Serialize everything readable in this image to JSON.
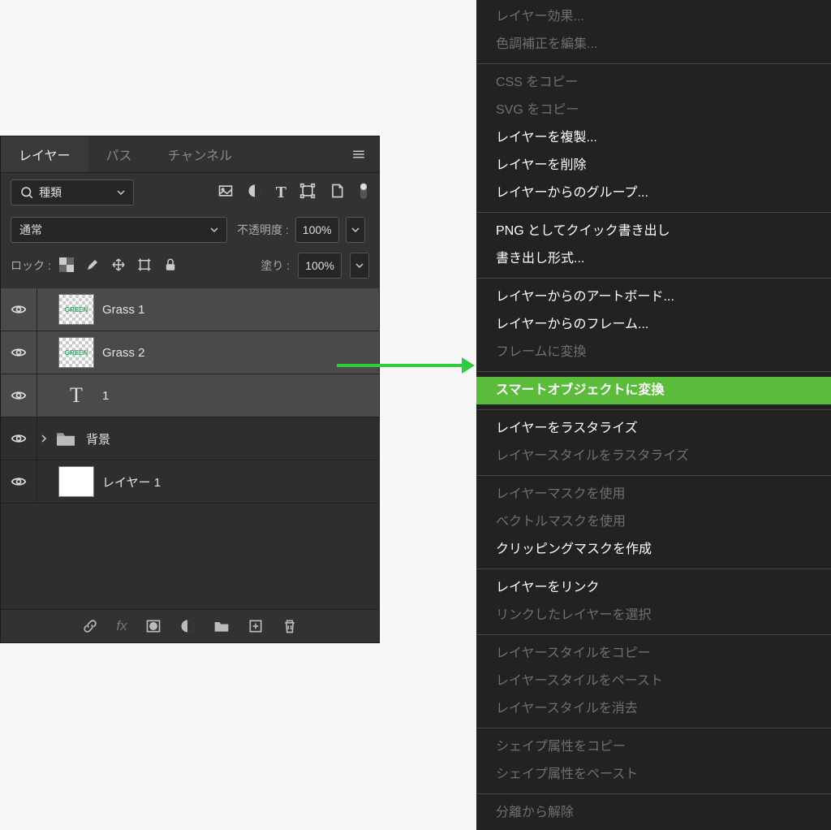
{
  "panel": {
    "tabs": {
      "layers": "レイヤー",
      "paths": "パス",
      "channels": "チャンネル"
    },
    "filter_label": "種類",
    "blend_mode": "通常",
    "opacity_label": "不透明度 :",
    "opacity_value": "100%",
    "lock_label": "ロック :",
    "fill_label": "塗り :",
    "fill_value": "100%",
    "layers": {
      "grass1": "Grass 1",
      "grass2": "Grass 2",
      "type1": "1",
      "bg_group": "背景",
      "layer1": "レイヤー 1",
      "type_glyph": "T"
    }
  },
  "menu": {
    "items": [
      {
        "label": "レイヤー効果...",
        "state": "disabled"
      },
      {
        "label": "色調補正を編集...",
        "state": "disabled"
      },
      {
        "sep": true
      },
      {
        "label": "CSS をコピー",
        "state": "disabled"
      },
      {
        "label": "SVG をコピー",
        "state": "disabled"
      },
      {
        "label": "レイヤーを複製...",
        "state": "enabled"
      },
      {
        "label": "レイヤーを削除",
        "state": "enabled"
      },
      {
        "label": "レイヤーからのグループ...",
        "state": "enabled"
      },
      {
        "sep": true
      },
      {
        "label": "PNG としてクイック書き出し",
        "state": "enabled"
      },
      {
        "label": "書き出し形式...",
        "state": "enabled"
      },
      {
        "sep": true
      },
      {
        "label": "レイヤーからのアートボード...",
        "state": "enabled"
      },
      {
        "label": "レイヤーからのフレーム...",
        "state": "enabled"
      },
      {
        "label": "フレームに変換",
        "state": "disabled"
      },
      {
        "sep": true
      },
      {
        "label": "スマートオブジェクトに変換",
        "state": "highlight"
      },
      {
        "sep": true
      },
      {
        "label": "レイヤーをラスタライズ",
        "state": "enabled"
      },
      {
        "label": "レイヤースタイルをラスタライズ",
        "state": "disabled"
      },
      {
        "sep": true
      },
      {
        "label": "レイヤーマスクを使用",
        "state": "disabled"
      },
      {
        "label": "ベクトルマスクを使用",
        "state": "disabled"
      },
      {
        "label": "クリッピングマスクを作成",
        "state": "enabled"
      },
      {
        "sep": true
      },
      {
        "label": "レイヤーをリンク",
        "state": "enabled"
      },
      {
        "label": "リンクしたレイヤーを選択",
        "state": "disabled"
      },
      {
        "sep": true
      },
      {
        "label": "レイヤースタイルをコピー",
        "state": "disabled"
      },
      {
        "label": "レイヤースタイルをペースト",
        "state": "disabled"
      },
      {
        "label": "レイヤースタイルを消去",
        "state": "disabled"
      },
      {
        "sep": true
      },
      {
        "label": "シェイプ属性をコピー",
        "state": "disabled"
      },
      {
        "label": "シェイプ属性をペースト",
        "state": "disabled"
      },
      {
        "sep": true
      },
      {
        "label": "分離から解除",
        "state": "disabled"
      }
    ]
  }
}
